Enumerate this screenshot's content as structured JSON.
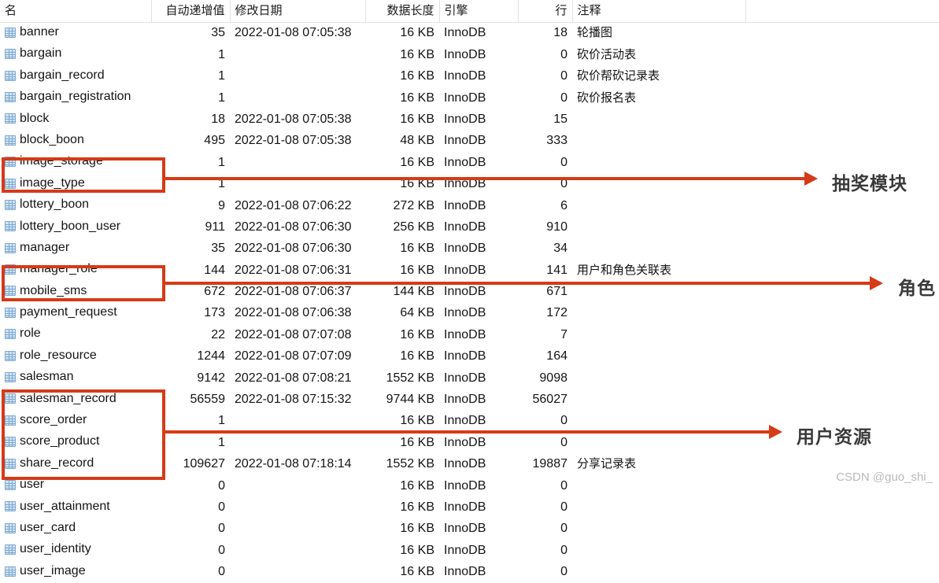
{
  "app": {
    "type": "database-table-list",
    "watermark": "CSDN @guo_shi_"
  },
  "columns": [
    {
      "key": "name",
      "label": "名",
      "align": "left"
    },
    {
      "key": "auto",
      "label": "自动递增值",
      "align": "right"
    },
    {
      "key": "date",
      "label": "修改日期",
      "align": "left"
    },
    {
      "key": "length",
      "label": "数据长度",
      "align": "right"
    },
    {
      "key": "engine",
      "label": "引擎",
      "align": "left"
    },
    {
      "key": "rows",
      "label": "行",
      "align": "right"
    },
    {
      "key": "comment",
      "label": "注释",
      "align": "left"
    }
  ],
  "rows": [
    {
      "name": "banner",
      "auto": "35",
      "date": "2022-01-08 07:05:38",
      "length": "16 KB",
      "engine": "InnoDB",
      "rows": "18",
      "comment": "轮播图"
    },
    {
      "name": "bargain",
      "auto": "1",
      "date": "",
      "length": "16 KB",
      "engine": "InnoDB",
      "rows": "0",
      "comment": "砍价活动表"
    },
    {
      "name": "bargain_record",
      "auto": "1",
      "date": "",
      "length": "16 KB",
      "engine": "InnoDB",
      "rows": "0",
      "comment": "砍价帮砍记录表"
    },
    {
      "name": "bargain_registration",
      "auto": "1",
      "date": "",
      "length": "16 KB",
      "engine": "InnoDB",
      "rows": "0",
      "comment": "砍价报名表"
    },
    {
      "name": "block",
      "auto": "18",
      "date": "2022-01-08 07:05:38",
      "length": "16 KB",
      "engine": "InnoDB",
      "rows": "15",
      "comment": ""
    },
    {
      "name": "block_boon",
      "auto": "495",
      "date": "2022-01-08 07:05:38",
      "length": "48 KB",
      "engine": "InnoDB",
      "rows": "333",
      "comment": ""
    },
    {
      "name": "image_storage",
      "auto": "1",
      "date": "",
      "length": "16 KB",
      "engine": "InnoDB",
      "rows": "0",
      "comment": ""
    },
    {
      "name": "image_type",
      "auto": "1",
      "date": "",
      "length": "16 KB",
      "engine": "InnoDB",
      "rows": "0",
      "comment": ""
    },
    {
      "name": "lottery_boon",
      "auto": "9",
      "date": "2022-01-08 07:06:22",
      "length": "272 KB",
      "engine": "InnoDB",
      "rows": "6",
      "comment": ""
    },
    {
      "name": "lottery_boon_user",
      "auto": "911",
      "date": "2022-01-08 07:06:30",
      "length": "256 KB",
      "engine": "InnoDB",
      "rows": "910",
      "comment": ""
    },
    {
      "name": "manager",
      "auto": "35",
      "date": "2022-01-08 07:06:30",
      "length": "16 KB",
      "engine": "InnoDB",
      "rows": "34",
      "comment": ""
    },
    {
      "name": "manager_role",
      "auto": "144",
      "date": "2022-01-08 07:06:31",
      "length": "16 KB",
      "engine": "InnoDB",
      "rows": "141",
      "comment": "用户和角色关联表"
    },
    {
      "name": "mobile_sms",
      "auto": "672",
      "date": "2022-01-08 07:06:37",
      "length": "144 KB",
      "engine": "InnoDB",
      "rows": "671",
      "comment": ""
    },
    {
      "name": "payment_request",
      "auto": "173",
      "date": "2022-01-08 07:06:38",
      "length": "64 KB",
      "engine": "InnoDB",
      "rows": "172",
      "comment": ""
    },
    {
      "name": "role",
      "auto": "22",
      "date": "2022-01-08 07:07:08",
      "length": "16 KB",
      "engine": "InnoDB",
      "rows": "7",
      "comment": ""
    },
    {
      "name": "role_resource",
      "auto": "1244",
      "date": "2022-01-08 07:07:09",
      "length": "16 KB",
      "engine": "InnoDB",
      "rows": "164",
      "comment": ""
    },
    {
      "name": "salesman",
      "auto": "9142",
      "date": "2022-01-08 07:08:21",
      "length": "1552 KB",
      "engine": "InnoDB",
      "rows": "9098",
      "comment": ""
    },
    {
      "name": "salesman_record",
      "auto": "56559",
      "date": "2022-01-08 07:15:32",
      "length": "9744 KB",
      "engine": "InnoDB",
      "rows": "56027",
      "comment": ""
    },
    {
      "name": "score_order",
      "auto": "1",
      "date": "",
      "length": "16 KB",
      "engine": "InnoDB",
      "rows": "0",
      "comment": ""
    },
    {
      "name": "score_product",
      "auto": "1",
      "date": "",
      "length": "16 KB",
      "engine": "InnoDB",
      "rows": "0",
      "comment": ""
    },
    {
      "name": "share_record",
      "auto": "109627",
      "date": "2022-01-08 07:18:14",
      "length": "1552 KB",
      "engine": "InnoDB",
      "rows": "19887",
      "comment": "分享记录表"
    },
    {
      "name": "user",
      "auto": "0",
      "date": "",
      "length": "16 KB",
      "engine": "InnoDB",
      "rows": "0",
      "comment": ""
    },
    {
      "name": "user_attainment",
      "auto": "0",
      "date": "",
      "length": "16 KB",
      "engine": "InnoDB",
      "rows": "0",
      "comment": ""
    },
    {
      "name": "user_card",
      "auto": "0",
      "date": "",
      "length": "16 KB",
      "engine": "InnoDB",
      "rows": "0",
      "comment": ""
    },
    {
      "name": "user_identity",
      "auto": "0",
      "date": "",
      "length": "16 KB",
      "engine": "InnoDB",
      "rows": "0",
      "comment": ""
    },
    {
      "name": "user_image",
      "auto": "0",
      "date": "",
      "length": "16 KB",
      "engine": "InnoDB",
      "rows": "0",
      "comment": ""
    }
  ],
  "annotations": {
    "color": "#d63a17",
    "items": [
      {
        "label": "抽奖模块",
        "tables": [
          "lottery_boon",
          "lottery_boon_user"
        ]
      },
      {
        "label": "角色",
        "tables": [
          "role",
          "role_resource"
        ]
      },
      {
        "label": "用户资源",
        "tables": [
          "user",
          "user_attainment",
          "user_card",
          "user_identity",
          "user_image"
        ]
      }
    ]
  }
}
